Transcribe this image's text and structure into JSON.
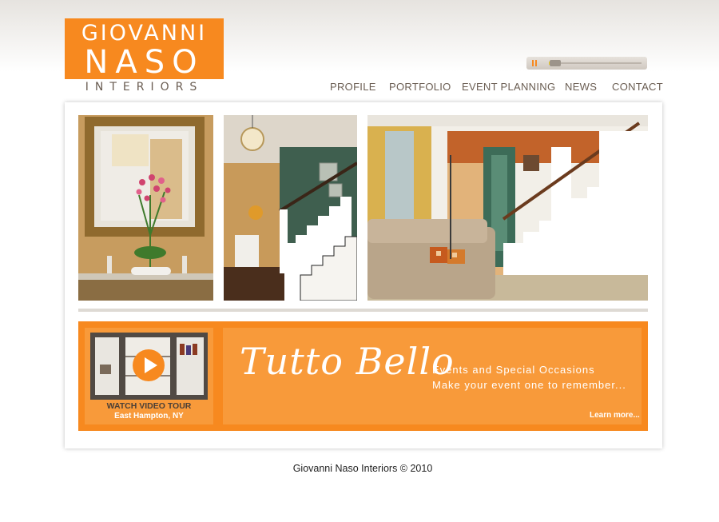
{
  "logo": {
    "line1": "GIOVANNI",
    "line2": "NASO",
    "sub": "INTERIORS",
    "brand_color": "#f7891f"
  },
  "player": {
    "state": "playing",
    "pause_icon": "pause-icon",
    "progress": 0.12
  },
  "nav": {
    "items": [
      "PROFILE",
      "PORTFOLIO",
      "EVENT PLANNING",
      "NEWS",
      "CONTACT"
    ]
  },
  "gallery": {
    "photos": [
      "entry-mirror-photo",
      "staircase-photo",
      "living-room-staircase-photo"
    ]
  },
  "video": {
    "caption": "WATCH VIDEO TOUR",
    "location": "East Hampton, NY",
    "play_icon": "play-icon"
  },
  "promo": {
    "title": "Tutto Bello",
    "line1": "Events and Special Occasions",
    "line2": "Make your event one to remember...",
    "link": "Learn more..."
  },
  "footer": {
    "copyright": "Giovanni Naso Interiors © 2010"
  }
}
